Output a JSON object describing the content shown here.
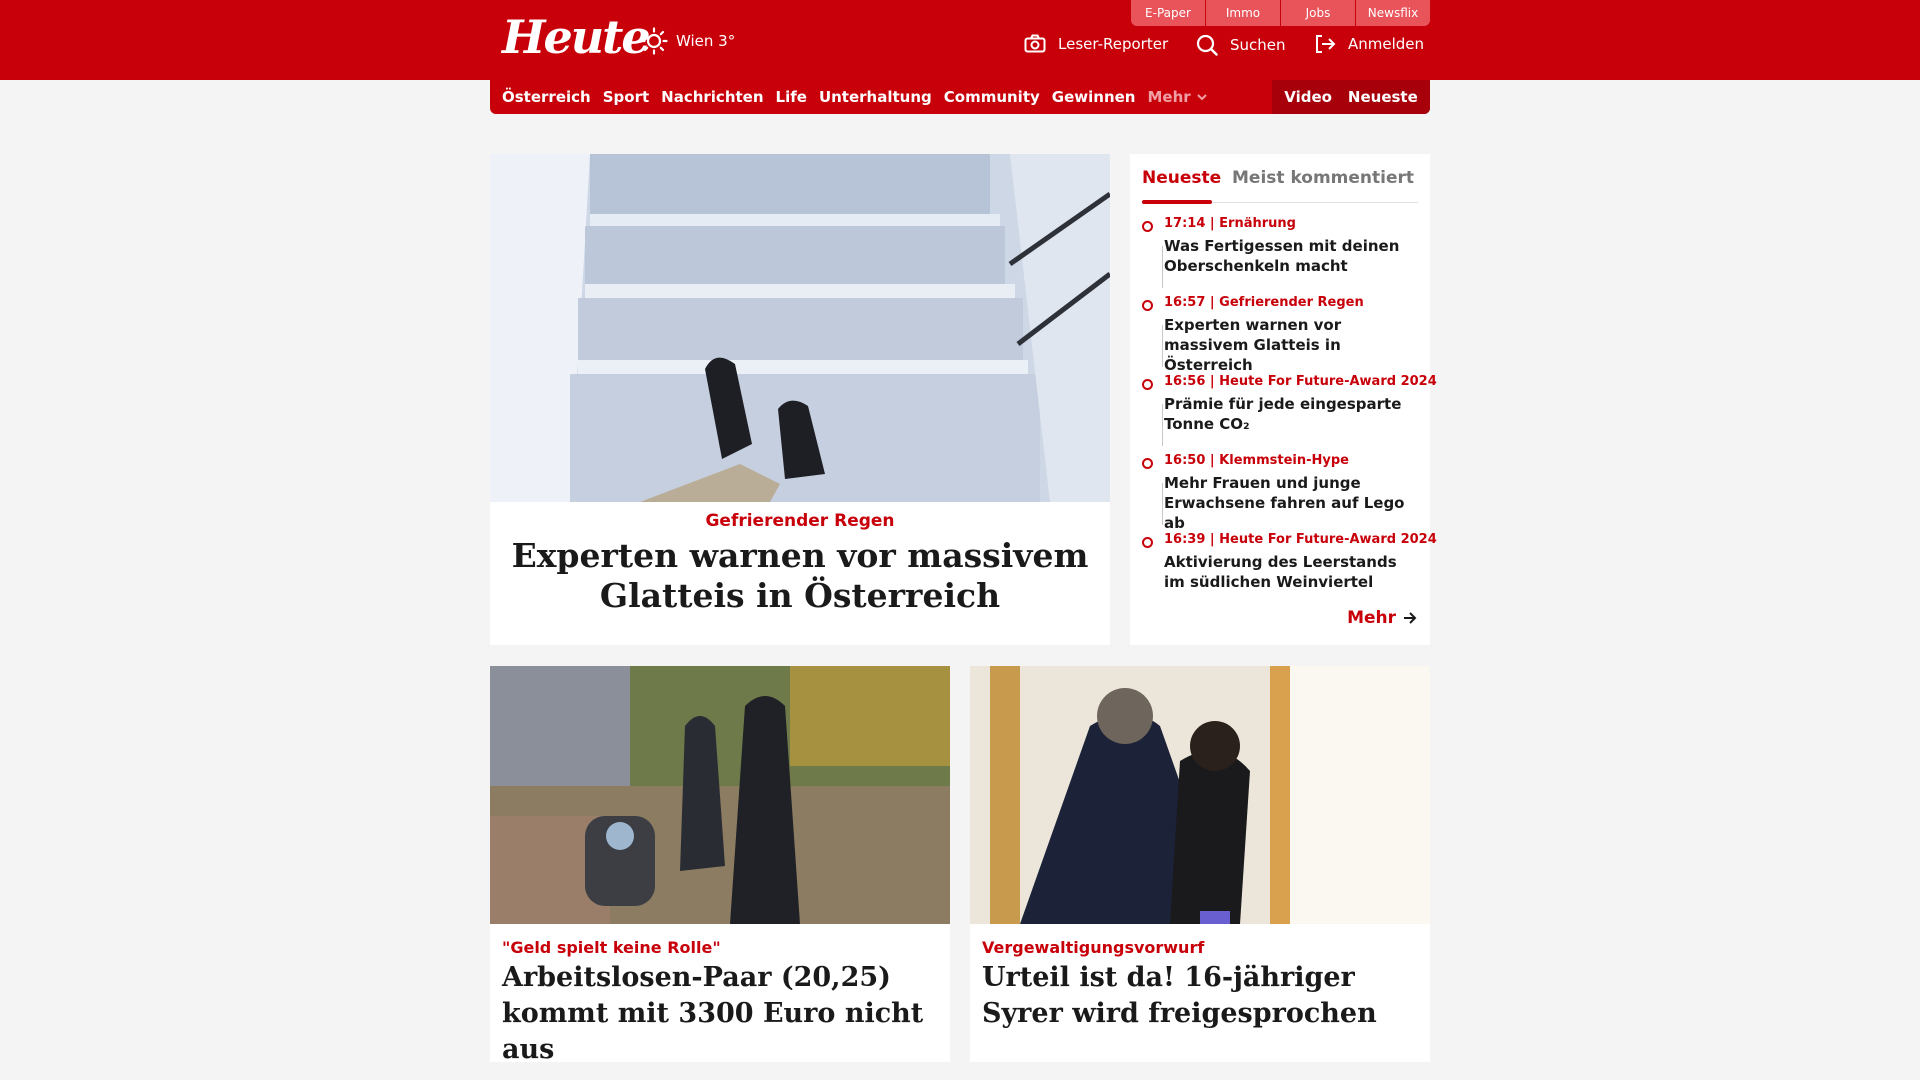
{
  "header": {
    "logo": "Heute",
    "weather": "Wien 3°",
    "top_links": [
      "E-Paper",
      "Immo",
      "Jobs",
      "Newsflix"
    ],
    "leser_reporter": "Leser-Reporter",
    "search": "Suchen",
    "login": "Anmelden"
  },
  "nav": {
    "items": [
      "Österreich",
      "Sport",
      "Nachrichten",
      "Life",
      "Unterhaltung",
      "Community",
      "Gewinnen"
    ],
    "more": "Mehr",
    "video": "Video",
    "latest": "Neueste"
  },
  "hero": {
    "kicker": "Gefrierender Regen",
    "title": "Experten warnen vor massivem Glatteis in Österreich"
  },
  "sidebar": {
    "tab_active": "Neueste",
    "tab_inactive": "Meist kommentiert",
    "items": [
      {
        "meta": "17:14 | Ernährung",
        "title": "Was Fertigessen mit deinen Oberschenkeln macht"
      },
      {
        "meta": "16:57 | Gefrierender Regen",
        "title": "Experten warnen vor massivem Glatteis in Österreich"
      },
      {
        "meta": "16:56 | Heute For Future-Award 2024",
        "title": "Prämie für jede eingesparte Tonne CO₂"
      },
      {
        "meta": "16:50 | Klemmstein-Hype",
        "title": "Mehr Frauen und junge Erwachsene fahren auf Lego ab"
      },
      {
        "meta": "16:39 | Heute For Future-Award 2024",
        "title": "Aktivierung des Leerstands im südlichen Weinviertel"
      }
    ],
    "more": "Mehr"
  },
  "cards": [
    {
      "kicker": "\"Geld spielt keine Rolle\"",
      "title": "Arbeitslosen-Paar (20,25) kommt mit 3300 Euro nicht aus"
    },
    {
      "kicker": "Vergewaltigungsvorwurf",
      "title": "Urteil ist da! 16-jähriger Syrer wird freigesprochen"
    }
  ],
  "colors": {
    "brand": "#c8000a",
    "background": "#f4f4f4"
  }
}
